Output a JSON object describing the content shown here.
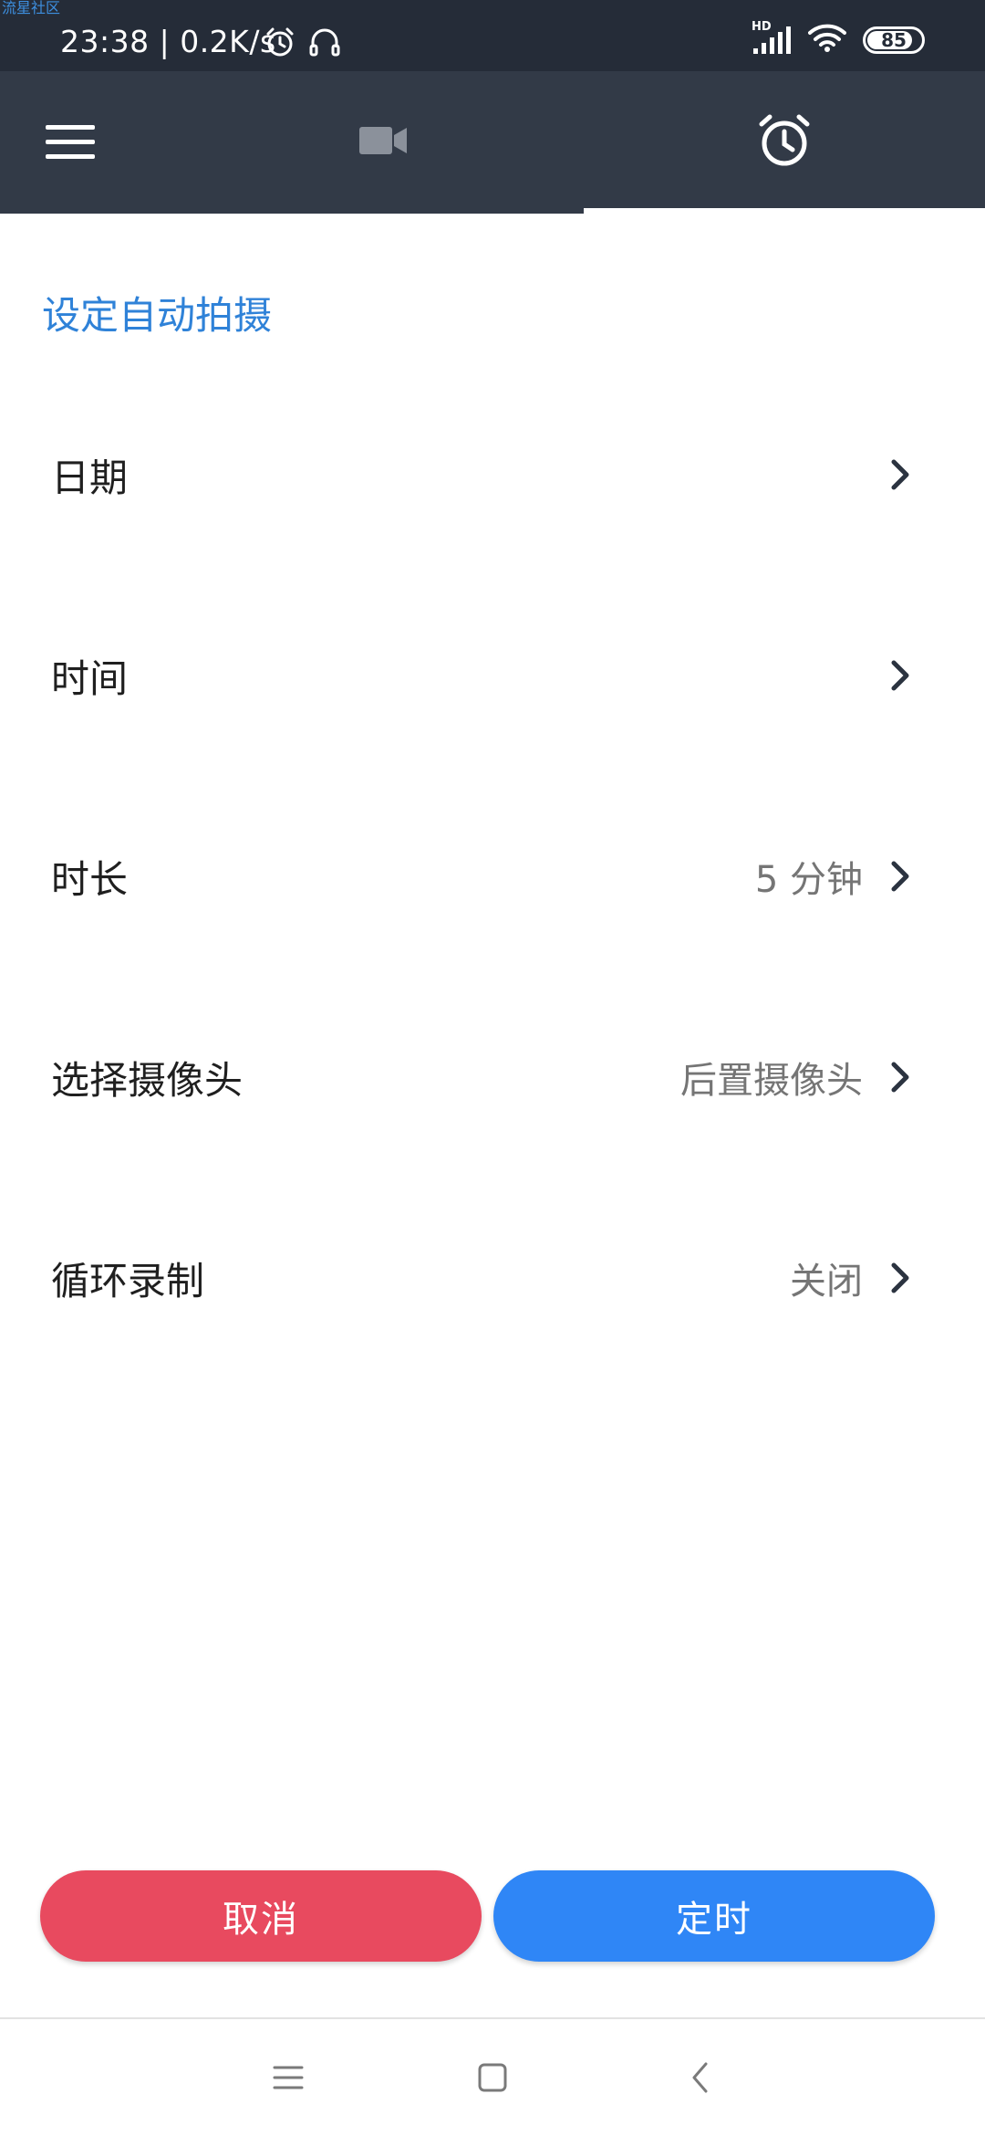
{
  "status_bar": {
    "watermark": "流星社区",
    "time_speed": "23:38 | 0.2K/s",
    "icons_left": [
      "alarm-icon",
      "headset-icon"
    ],
    "icons_right": [
      "hd-signal-icon",
      "wifi-icon",
      "battery-icon"
    ],
    "signal_badge": "HD",
    "battery_level": "85",
    "battery_fraction": 0.85
  },
  "app_bar": {
    "menu_icon": "hamburger-menu-icon",
    "tabs": [
      {
        "icon": "video-camera-icon",
        "selected": false
      },
      {
        "icon": "alarm-clock-icon",
        "selected": true
      }
    ]
  },
  "section": {
    "title": "设定自动拍摄"
  },
  "settings": [
    {
      "label": "日期",
      "value": ""
    },
    {
      "label": "时间",
      "value": ""
    },
    {
      "label": "时长",
      "value": "5 分钟"
    },
    {
      "label": "选择摄像头",
      "value": "后置摄像头"
    },
    {
      "label": "循环录制",
      "value": "关闭"
    }
  ],
  "buttons": {
    "cancel": "取消",
    "confirm": "定时"
  },
  "nav_bar": {
    "items": [
      "recents-icon",
      "home-icon",
      "back-icon"
    ]
  },
  "colors": {
    "status_bar_bg": "#252c38",
    "app_bar_bg": "#323a47",
    "accent": "#2f82d8",
    "cancel": "#e84a5f",
    "confirm": "#2f86f6"
  }
}
